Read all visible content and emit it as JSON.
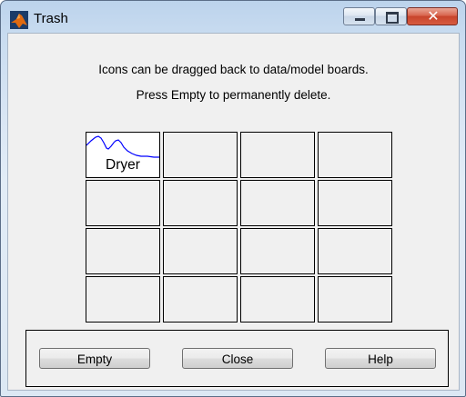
{
  "window": {
    "title": "Trash",
    "close_glyph": "✕"
  },
  "messages": {
    "line1": "Icons can be dragged back to data/model boards.",
    "line2": "Press Empty to permanently delete."
  },
  "grid": {
    "rows": 4,
    "columns": 4,
    "items": [
      {
        "label": "Dryer",
        "icon": "waveform-thumbnail-icon"
      }
    ]
  },
  "buttons": {
    "empty": "Empty",
    "close": "Close",
    "help": "Help"
  },
  "colors": {
    "waveform": "#0000ff",
    "matlab_icon": "#e06a10"
  }
}
